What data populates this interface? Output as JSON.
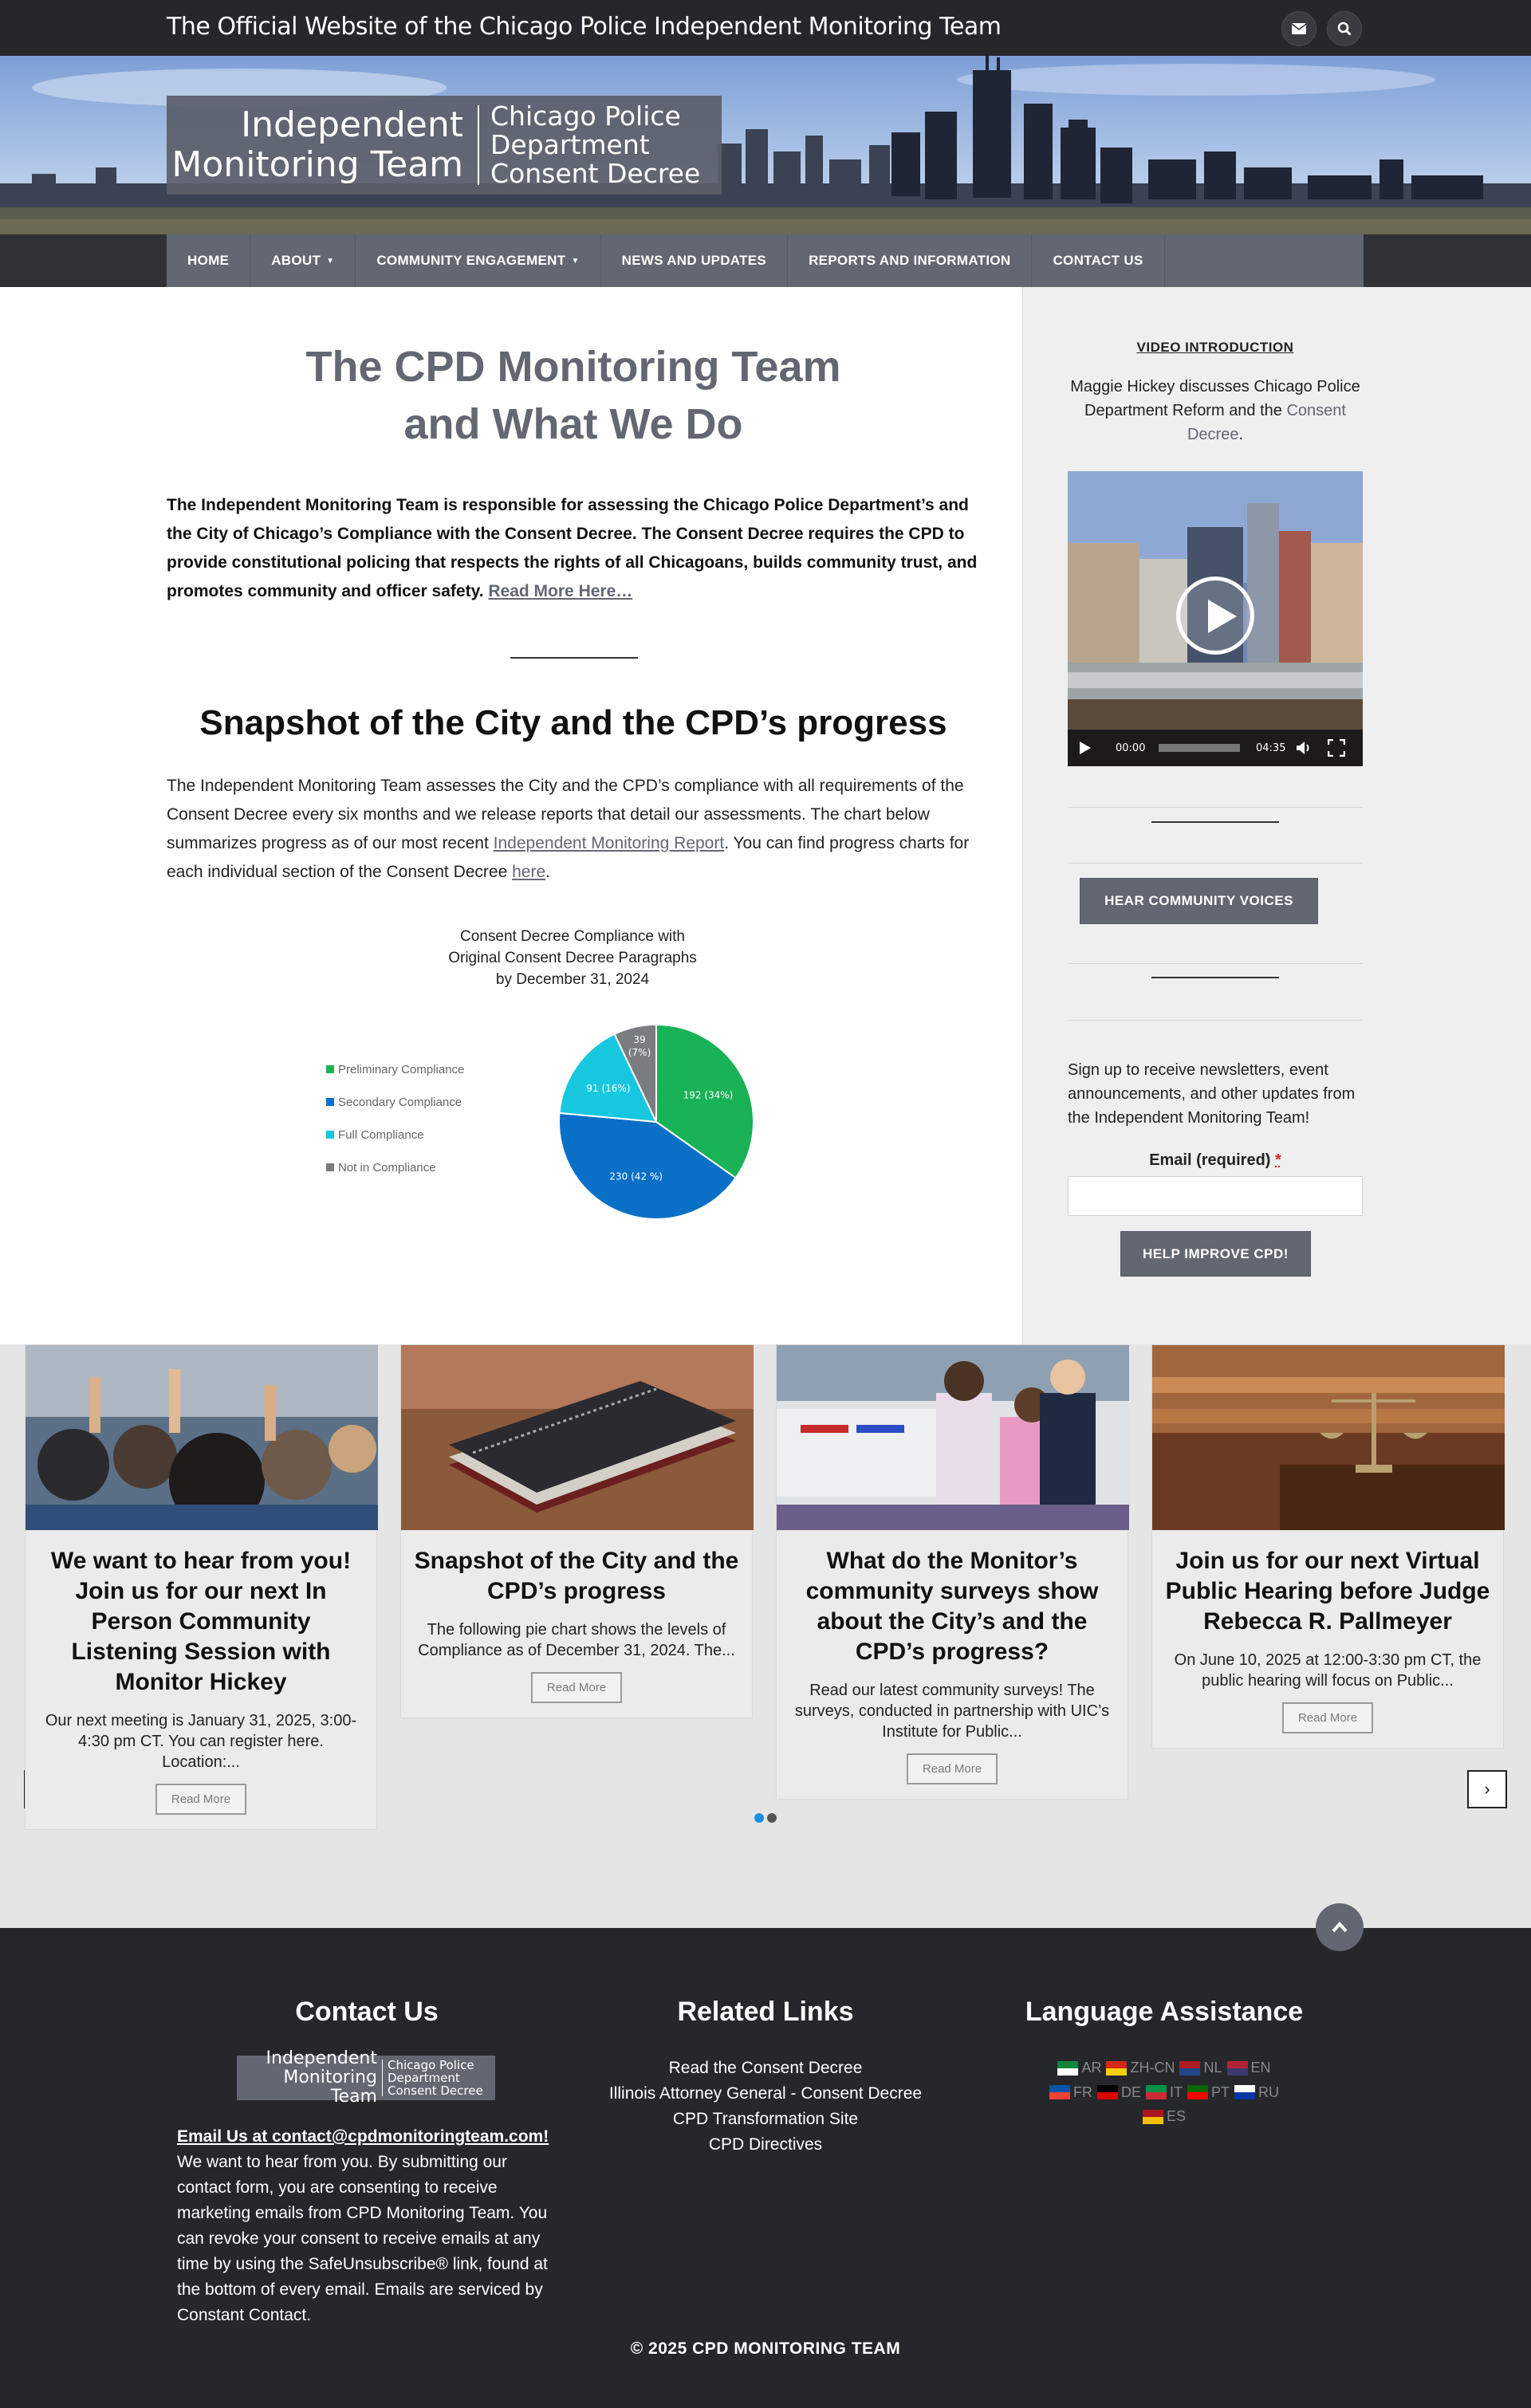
{
  "header": {
    "site_title": "The Official Website of the Chicago Police Independent Monitoring Team",
    "icons": [
      "envelope-icon",
      "search-icon"
    ]
  },
  "logo": {
    "left_line1": "Independent",
    "left_line2": "Monitoring Team",
    "right_line1": "Chicago Police",
    "right_line2": "Department",
    "right_line3": "Consent Decree"
  },
  "nav": {
    "items": [
      {
        "label": "HOME",
        "dropdown": false
      },
      {
        "label": "ABOUT",
        "dropdown": true
      },
      {
        "label": "COMMUNITY ENGAGEMENT",
        "dropdown": true
      },
      {
        "label": "NEWS AND UPDATES",
        "dropdown": false
      },
      {
        "label": "REPORTS AND INFORMATION",
        "dropdown": false
      },
      {
        "label": "CONTACT US",
        "dropdown": false
      }
    ]
  },
  "main": {
    "title_line1": "The CPD Monitoring Team",
    "title_line2": "and What We Do",
    "intro": "The Independent Monitoring Team is responsible for assessing the Chicago Police Department’s and the City of Chicago’s Compliance with the Consent Decree. The Consent Decree requires the CPD to provide constitutional policing that respects the rights of all Chicagoans, builds community trust, and promotes community and officer safety.",
    "intro_link": "Read More Here…",
    "snapshot_title": "Snapshot of the City and the CPD’s progress",
    "snapshot_text1": "The Independent Monitoring Team assesses the City and the CPD’s compliance with all requirements of the Consent Decree every six months and we release reports that detail our assessments. The chart below summarizes progress as of our most recent ",
    "snapshot_link1": "Independent Monitoring Report",
    "snapshot_text2": ". You can find progress charts for each individual section of the Consent Decree ",
    "snapshot_link2": "here",
    "snapshot_text3": "."
  },
  "chart_data": {
    "type": "pie",
    "title": [
      "Consent Decree Compliance with",
      "Original Consent Decree Paragraphs",
      "by December 31, 2024"
    ],
    "legend_position": "left",
    "slices": [
      {
        "name": "Preliminary Compliance",
        "value": 192,
        "label": "192 (34%)",
        "color": "#19b256"
      },
      {
        "name": "Secondary Compliance",
        "value": 230,
        "label": "230 (42 %)",
        "color": "#0a70c7"
      },
      {
        "name": "Full Compliance",
        "value": 91,
        "label": "91 (16%)",
        "color": "#17c7e0"
      },
      {
        "name": "Not in Compliance",
        "value": 39,
        "label": "39 (7%)",
        "color": "#7b7c80"
      }
    ]
  },
  "sidebar": {
    "video_heading": "VIDEO INTRODUCTION",
    "video_desc1": "Maggie Hickey discusses Chicago Police Department Reform and the",
    "video_desc_link": "Consent Decree",
    "video_desc2": ".",
    "video_time_current": "00:00",
    "video_time_total": "04:35",
    "video_progress": 0,
    "community_button": "HEAR COMMUNITY VOICES",
    "signup_text": "Sign up to receive newsletters, event announcements, and other updates from the Independent Monitoring Team!",
    "email_label": "Email (required)",
    "email_required_mark": "*",
    "email_value": "",
    "submit_button": "HELP IMPROVE CPD!"
  },
  "slider": {
    "cards": [
      {
        "title": "We want to hear from you! Join us for our next In Person Community Listening Session with Monitor Hickey",
        "excerpt": "Our next meeting is January 31, 2025, 3:00-4:30 pm CT. You can register here. Location:...",
        "button": "Read More",
        "image": "audience-raising-hands"
      },
      {
        "title": "Snapshot of the City and the CPD’s progress",
        "excerpt": "The following pie chart shows the levels of Compliance as of December 31, 2024. The...",
        "button": "Read More",
        "image": "stack-of-notebooks"
      },
      {
        "title": "What do the Monitor’s community surveys show about the City’s and the CPD’s progress?",
        "excerpt": "Read our latest community surveys! The surveys, conducted in partnership with UIC’s Institute for Public...",
        "button": "Read More",
        "image": "officer-with-girls"
      },
      {
        "title": "Join us for our next Virtual Public Hearing before Judge Rebecca R. Pallmeyer",
        "excerpt": "On June 10, 2025 at 12:00-3:30 pm CT, the public hearing will focus on Public...",
        "button": "Read More",
        "image": "courtroom-scales"
      }
    ],
    "prev": "‹",
    "next": "›",
    "active_dot": 0
  },
  "footer": {
    "contact_heading": "Contact Us",
    "email_link": "Email Us at contact@cpdmonitoringteam.com!",
    "contact_text": "We want to hear from you.  By submitting our contact form, you are consenting to receive marketing emails from CPD Monitoring Team. You can revoke your consent to receive emails at any time by using the SafeUnsubscribe® link, found at the bottom of every email. Emails are serviced by Constant Contact.",
    "links_heading": "Related Links",
    "links": [
      "Read the Consent Decree",
      "Illinois Attorney General - Consent Decree",
      "CPD Transformation Site",
      "CPD Directives"
    ],
    "lang_heading": "Language Assistance",
    "languages": [
      "AR",
      "ZH-CN",
      "NL",
      "EN",
      "FR",
      "DE",
      "IT",
      "PT",
      "RU",
      "ES"
    ],
    "copyright": "© 2025 CPD MONITORING TEAM"
  }
}
